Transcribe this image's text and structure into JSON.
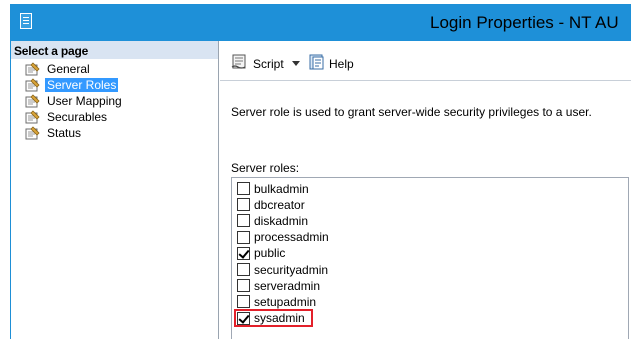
{
  "window": {
    "title": "Login Properties - NT AU"
  },
  "left_pane": {
    "header": "Select a page",
    "pages": [
      {
        "label": "General",
        "icon": "wrench-page-icon",
        "selected": false
      },
      {
        "label": "Server Roles",
        "icon": "wrench-page-icon",
        "selected": true
      },
      {
        "label": "User Mapping",
        "icon": "wrench-page-icon",
        "selected": false
      },
      {
        "label": "Securables",
        "icon": "wrench-page-icon",
        "selected": false
      },
      {
        "label": "Status",
        "icon": "wrench-page-icon",
        "selected": false
      }
    ]
  },
  "toolbar": {
    "script_label": "Script",
    "help_label": "Help"
  },
  "content": {
    "description": "Server role is used to grant server-wide security privileges to a user.",
    "roles_label": "Server roles:",
    "roles": [
      {
        "name": "bulkadmin",
        "checked": false
      },
      {
        "name": "dbcreator",
        "checked": false
      },
      {
        "name": "diskadmin",
        "checked": false
      },
      {
        "name": "processadmin",
        "checked": false
      },
      {
        "name": "public",
        "checked": true
      },
      {
        "name": "securityadmin",
        "checked": false
      },
      {
        "name": "serveradmin",
        "checked": false
      },
      {
        "name": "setupadmin",
        "checked": false
      },
      {
        "name": "sysadmin",
        "checked": true,
        "highlighted": true
      }
    ]
  },
  "colors": {
    "titlebar": "#1e90d8",
    "selection": "#3399ff",
    "highlight_border": "#e3202a"
  }
}
